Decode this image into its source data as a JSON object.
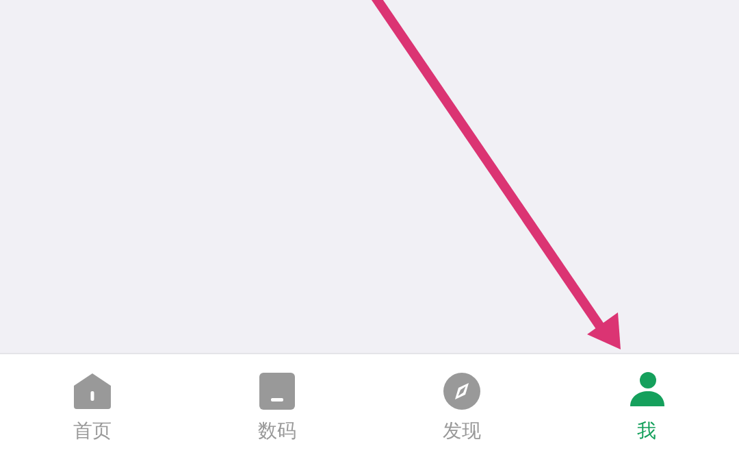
{
  "tabs": [
    {
      "kind": "home",
      "label": "首页",
      "selected": false
    },
    {
      "kind": "device",
      "label": "数码",
      "selected": false
    },
    {
      "kind": "compass",
      "label": "发现",
      "selected": false
    },
    {
      "kind": "person",
      "label": "我",
      "selected": true
    }
  ]
}
